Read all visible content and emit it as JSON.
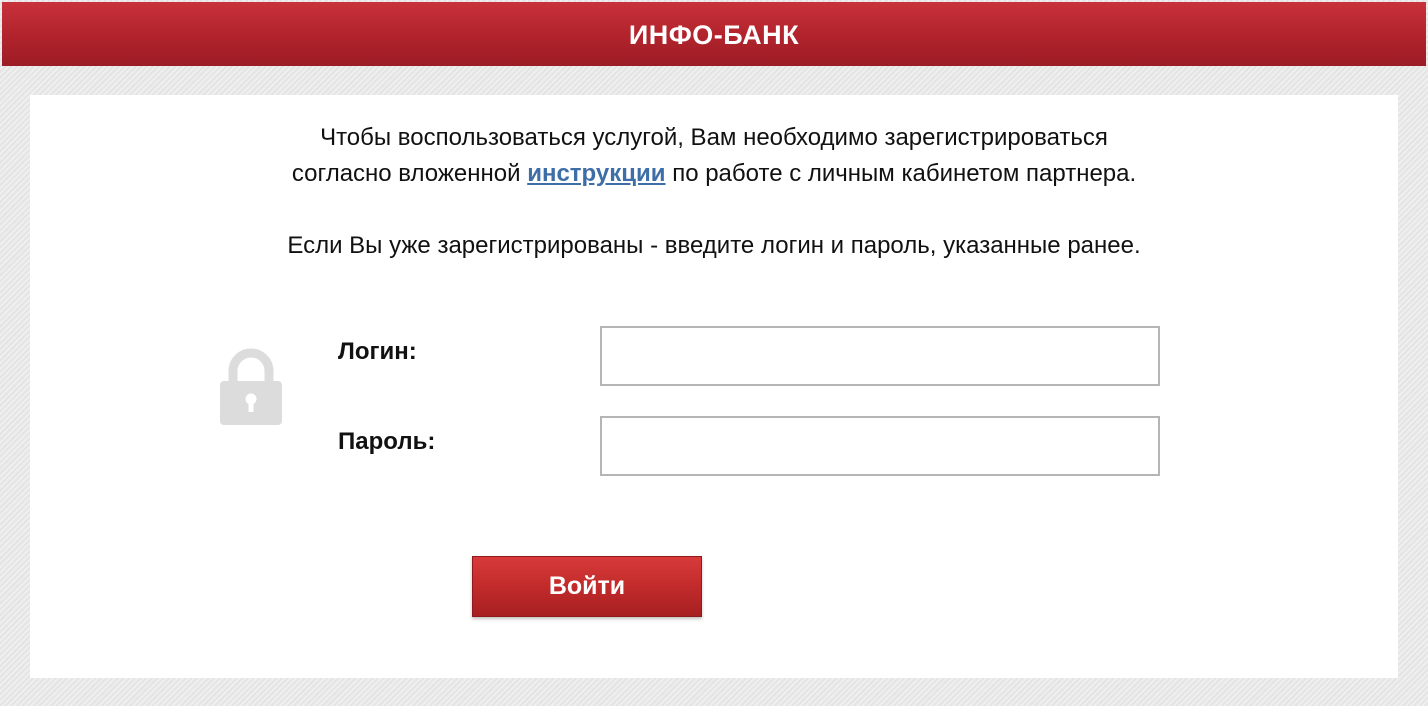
{
  "header": {
    "title": "ИНФО-БАНК"
  },
  "intro": {
    "line1": "Чтобы воспользоваться услугой, Вам необходимо зарегистрироваться",
    "line2_before": "согласно вложенной ",
    "line2_link": "инструкции",
    "line2_after": " по работе с личным кабинетом партнера.",
    "line3": "Если Вы уже зарегистрированы - введите логин и пароль, указанные ранее."
  },
  "form": {
    "login_label": "Логин:",
    "login_value": "",
    "password_label": "Пароль:",
    "password_value": "",
    "submit_label": "Войти"
  },
  "icons": {
    "lock": "lock-icon"
  },
  "colors": {
    "brand_red": "#b3242d",
    "link_blue": "#3e6ea8",
    "lock_gray": "#dcdcdc"
  }
}
